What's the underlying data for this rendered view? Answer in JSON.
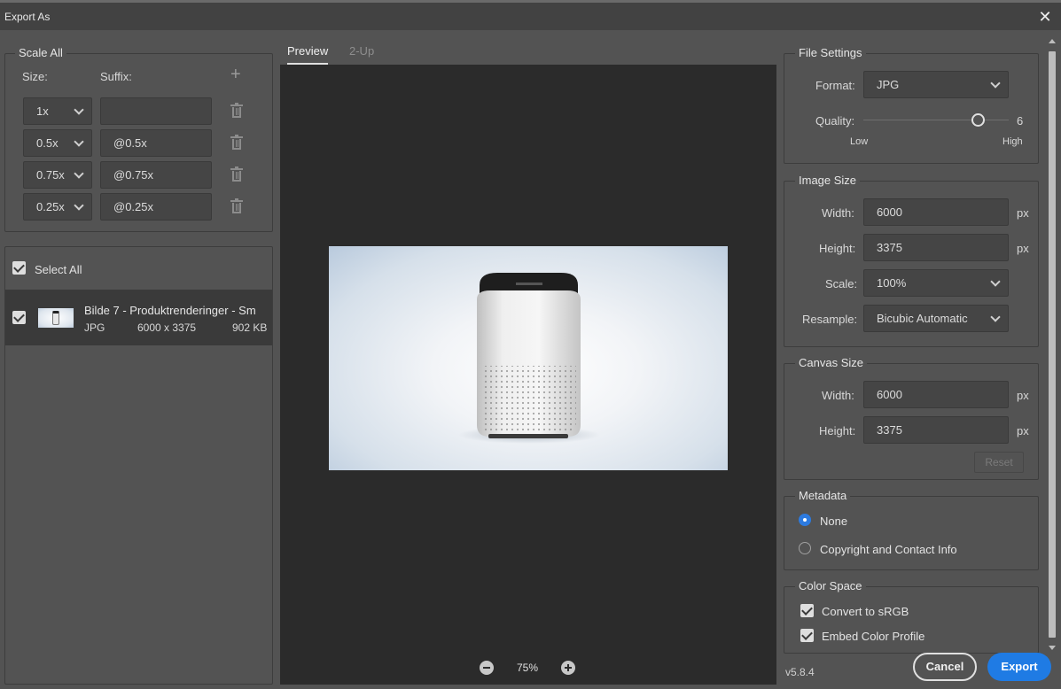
{
  "window": {
    "title": "Export As",
    "close_glyph": "✕"
  },
  "scale_panel": {
    "legend": "Scale All",
    "size_header": "Size:",
    "suffix_header": "Suffix:",
    "add_glyph": "+",
    "rows": [
      {
        "size": "1x",
        "suffix": ""
      },
      {
        "size": "0.5x",
        "suffix": "@0.5x"
      },
      {
        "size": "0.75x",
        "suffix": "@0.75x"
      },
      {
        "size": "0.25x",
        "suffix": "@0.25x"
      }
    ]
  },
  "assets": {
    "select_all_label": "Select All",
    "items": [
      {
        "name": "Bilde 7 - Produktrenderinger - Sm",
        "format": "JPG",
        "dimensions": "6000 x 3375",
        "size": "902 KB"
      }
    ]
  },
  "preview": {
    "tabs": [
      "Preview",
      "2-Up"
    ],
    "active_tab": "Preview",
    "zoom": "75%"
  },
  "file_settings": {
    "legend": "File Settings",
    "format_label": "Format:",
    "format_value": "JPG",
    "quality_label": "Quality:",
    "quality_value": "6",
    "quality_fraction": 0.86,
    "quality_low": "Low",
    "quality_high": "High"
  },
  "image_size": {
    "legend": "Image Size",
    "width_label": "Width:",
    "width_value": "6000",
    "height_label": "Height:",
    "height_value": "3375",
    "unit": "px",
    "scale_label": "Scale:",
    "scale_value": "100%",
    "resample_label": "Resample:",
    "resample_value": "Bicubic Automatic"
  },
  "canvas_size": {
    "legend": "Canvas Size",
    "width_label": "Width:",
    "width_value": "6000",
    "height_label": "Height:",
    "height_value": "3375",
    "unit": "px",
    "reset_label": "Reset"
  },
  "metadata": {
    "legend": "Metadata",
    "options": [
      "None",
      "Copyright and Contact Info"
    ],
    "selected": "None"
  },
  "color_space": {
    "legend": "Color Space",
    "convert_label": "Convert to sRGB",
    "embed_label": "Embed Color Profile"
  },
  "footer": {
    "version": "v5.8.4",
    "cancel_label": "Cancel",
    "export_label": "Export"
  },
  "colors": {
    "accent": "#1f7be4",
    "background": "#535353",
    "preview_bg": "#2b2b2b"
  }
}
